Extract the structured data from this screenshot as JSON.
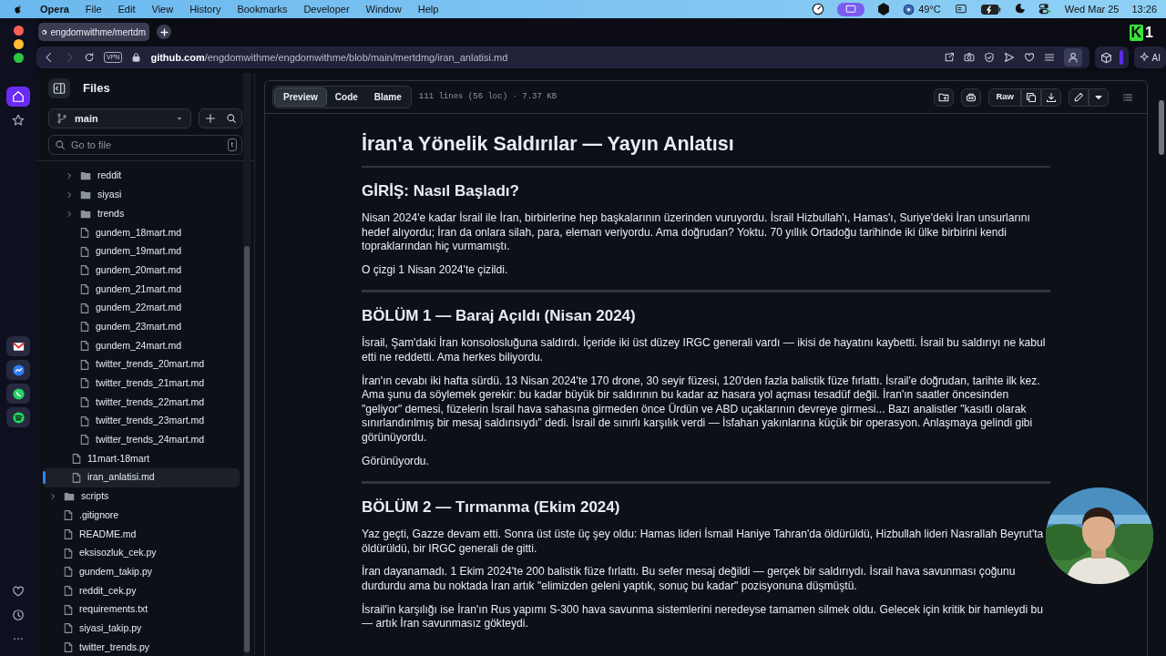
{
  "menubar": {
    "app": "Opera",
    "menus": [
      "File",
      "Edit",
      "View",
      "History",
      "Bookmarks",
      "Developer",
      "Window",
      "Help"
    ],
    "temperature": "49°C",
    "date": "Wed Mar 25",
    "time": "13:26"
  },
  "browser": {
    "tab": {
      "title": "engdomwithme/mertdm",
      "selected": true
    },
    "vpn": "VPN",
    "url_host": "github.com",
    "url_path": "/engdomwithme/engdomwithme/blob/main/mertdmg/iran_anlatisi.md",
    "ai_button": "AI",
    "badge": {
      "logo": "K",
      "count": "1"
    }
  },
  "files_panel": {
    "title": "Files",
    "branch": "main",
    "search": {
      "placeholder": "Go to file",
      "shortcut": "t"
    },
    "tree": [
      {
        "children": [
          {
            "children": [
              {
                "name": "reddit",
                "kind": "folder",
                "expanded": false,
                "selected": false
              },
              {
                "name": "siyasi",
                "kind": "folder",
                "expanded": false,
                "selected": false
              },
              {
                "name": "trends",
                "kind": "folder",
                "expanded": false,
                "selected": false
              },
              {
                "name": "gundem_18mart.md",
                "kind": "file",
                "selected": false
              },
              {
                "name": "gundem_19mart.md",
                "kind": "file",
                "selected": false
              },
              {
                "name": "gundem_20mart.md",
                "kind": "file",
                "selected": false
              },
              {
                "name": "gundem_21mart.md",
                "kind": "file",
                "selected": false
              },
              {
                "name": "gundem_22mart.md",
                "kind": "file",
                "selected": false
              },
              {
                "name": "gundem_23mart.md",
                "kind": "file",
                "selected": false
              },
              {
                "name": "gundem_24mart.md",
                "kind": "file",
                "selected": false
              },
              {
                "name": "twitter_trends_20mart.md",
                "kind": "file",
                "selected": false
              },
              {
                "name": "twitter_trends_21mart.md",
                "kind": "file",
                "selected": false
              },
              {
                "name": "twitter_trends_22mart.md",
                "kind": "file",
                "selected": false
              },
              {
                "name": "twitter_trends_23mart.md",
                "kind": "file",
                "selected": false
              },
              {
                "name": "twitter_trends_24mart.md",
                "kind": "file",
                "selected": false
              }
            ]
          },
          {
            "name": "11mart-18mart",
            "kind": "file",
            "selected": false
          },
          {
            "name": "iran_anlatisi.md",
            "kind": "file",
            "selected": true
          }
        ]
      },
      {
        "name": "scripts",
        "kind": "folder",
        "expanded": false,
        "selected": false
      },
      {
        "name": ".gitignore",
        "kind": "file",
        "selected": false
      },
      {
        "name": "README.md",
        "kind": "file",
        "selected": false
      },
      {
        "name": "eksisozluk_cek.py",
        "kind": "file",
        "selected": false
      },
      {
        "name": "gundem_takip.py",
        "kind": "file",
        "selected": false
      },
      {
        "name": "reddit_cek.py",
        "kind": "file",
        "selected": false
      },
      {
        "name": "requirements.txt",
        "kind": "file",
        "selected": false
      },
      {
        "name": "siyasi_takip.py",
        "kind": "file",
        "selected": false
      },
      {
        "name": "twitter_trends.py",
        "kind": "file",
        "selected": false
      }
    ]
  },
  "file_view": {
    "tabs": [
      {
        "label": "Preview",
        "selected": true
      },
      {
        "label": "Code",
        "selected": false
      },
      {
        "label": "Blame",
        "selected": false
      }
    ],
    "info": "111 lines (56 loc) · 7.37 KB",
    "raw_button": "Raw",
    "blocks": [
      {
        "kind": "h1",
        "text": "İran'a Yönelik Saldırılar — Yayın Anlatısı"
      },
      {
        "kind": "h2",
        "text": "GİRİŞ: Nasıl Başladı?"
      },
      {
        "kind": "p",
        "text": "Nisan 2024'e kadar İsrail ile İran, birbirlerine hep başkalarının üzerinden vuruyordu. İsrail Hizbullah'ı, Hamas'ı, Suriye'deki İran unsurlarını hedef alıyordu; İran da onlara silah, para, eleman veriyordu. Ama doğrudan? Yoktu. 70 yıllık Ortadoğu tarihinde iki ülke birbirini kendi topraklarından hiç vurmamıştı."
      },
      {
        "kind": "p",
        "text": "O çizgi 1 Nisan 2024'te çizildi."
      },
      {
        "kind": "rule"
      },
      {
        "kind": "h2",
        "text": "BÖLÜM 1 — Baraj Açıldı (Nisan 2024)"
      },
      {
        "kind": "p",
        "text": "İsrail, Şam'daki İran konsolosluğuna saldırdı. İçeride iki üst düzey IRGC generali vardı — ikisi de hayatını kaybetti. İsrail bu saldırıyı ne kabul etti ne reddetti. Ama herkes biliyordu."
      },
      {
        "kind": "p",
        "text": "İran'ın cevabı iki hafta sürdü. 13 Nisan 2024'te 170 drone, 30 seyir füzesi, 120'den fazla balistik füze fırlattı. İsrail'e doğrudan, tarihte ilk kez. Ama şunu da söylemek gerekir: bu kadar büyük bir saldırının bu kadar az hasara yol açması tesadüf değil. İran'ın saatler öncesinden \"geliyor\" demesi, füzelerin İsrail hava sahasına girmeden önce Ürdün ve ABD uçaklarının devreye girmesi... Bazı analistler \"kasıtlı olarak sınırlandırılmış bir mesaj saldırısıydı\" dedi. İsrail de sınırlı karşılık verdi — İsfahan yakınlarına küçük bir operasyon. Anlaşmaya gelindi gibi görünüyordu."
      },
      {
        "kind": "p",
        "text": "Görünüyordu."
      },
      {
        "kind": "rule"
      },
      {
        "kind": "h2",
        "text": "BÖLÜM 2 — Tırmanma (Ekim 2024)"
      },
      {
        "kind": "p",
        "text": "Yaz geçti, Gazze devam etti. Sonra üst üste üç şey oldu: Hamas lideri İsmail Haniye Tahran'da öldürüldü, Hizbullah lideri Nasrallah Beyrut'ta öldürüldü, bir IRGC generali de gitti."
      },
      {
        "kind": "p",
        "text": "İran dayanamadı. 1 Ekim 2024'te 200 balistik füze fırlattı. Bu sefer mesaj değildi — gerçek bir saldırıydı. İsrail hava savunması çoğunu durdurdu ama bu noktada İran artık \"elimizden geleni yaptık, sonuç bu kadar\" pozisyonuna düşmüştü."
      },
      {
        "kind": "p",
        "text": "İsrail'in karşılığı ise İran'ın Rus yapımı S-300 hava savunma sistemlerini neredeyse tamamen silmek oldu. Gelecek için kritik bir hamleydi bu — artık İran savunmasız gökteydi."
      }
    ]
  }
}
